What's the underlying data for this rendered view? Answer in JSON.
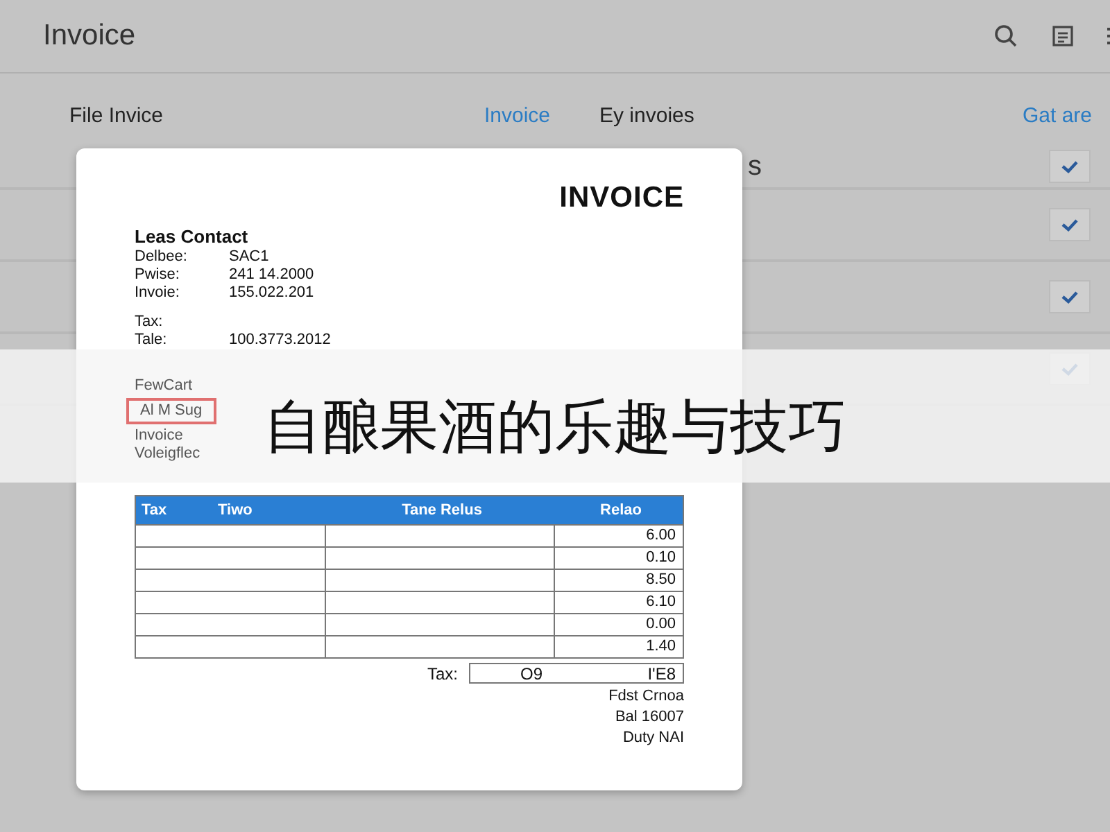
{
  "app": {
    "title": "Invoice"
  },
  "columns": [
    "File Invice",
    "Invoice",
    "Ey invoies",
    "Gat are"
  ],
  "column_link": [
    false,
    true,
    false,
    true
  ],
  "rows": [
    {
      "text": "s",
      "checked": true
    },
    {
      "checked": true
    },
    {
      "checked": true
    },
    {
      "checked": true
    }
  ],
  "document": {
    "title": "INVOICE",
    "contact_heading": "Leas Contact",
    "fields": [
      {
        "label": "Delbee:",
        "value": "SAC1"
      },
      {
        "label": "Pwise:",
        "value": "241 14.2000"
      },
      {
        "label": "Invoie:",
        "value": "155.022.201"
      },
      {
        "label": "Tax:"
      },
      {
        "label": "Tale:",
        "value": "100.3773.2012"
      }
    ],
    "faded_lines": [
      {
        "text": "FewCart",
        "highlighted": false
      },
      {
        "text": "Al M Sug",
        "highlighted": true
      },
      {
        "text": "Invoice",
        "highlighted": false
      },
      {
        "text": "Voleigflec",
        "highlighted": false
      }
    ],
    "table": {
      "columns": [
        "Tax",
        "Tiwo",
        "Tane Relus",
        "Relao"
      ],
      "rows": [
        "6.00",
        "0.10",
        "8.50",
        "6.10",
        "0.00",
        "1.40"
      ]
    },
    "tax_row": {
      "label": "Tax:",
      "value_1": "O9",
      "value_2": "I'E8"
    },
    "footer_lines": [
      "Fdst Crnoa",
      "Bal 16007",
      "Duty NAI"
    ]
  },
  "banner": {
    "title": "自酿果酒的乐趣与技巧"
  }
}
